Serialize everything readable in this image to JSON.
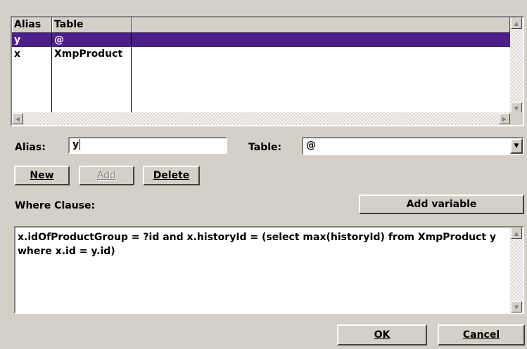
{
  "grid": {
    "columns": [
      "Alias",
      "Table"
    ],
    "rows": [
      {
        "alias": "y",
        "table": "@",
        "selected": true
      },
      {
        "alias": "x",
        "table": "XmpProduct",
        "selected": false
      }
    ]
  },
  "form": {
    "alias_label": "Alias:",
    "alias_value": "y",
    "table_label": "Table:",
    "table_value": "@"
  },
  "buttons": {
    "new": "New",
    "add": "Add",
    "delete": "Delete",
    "add_variable": "Add variable",
    "ok": "OK",
    "cancel": "Cancel"
  },
  "where": {
    "label": "Where Clause:",
    "text": "x.idOfProductGroup = ?id and x.historyId = (select max(historyId) from XmpProduct y where x.id = y.id)"
  },
  "colors": {
    "selection": "#4c1f8a",
    "face": "#d4d0c8"
  }
}
